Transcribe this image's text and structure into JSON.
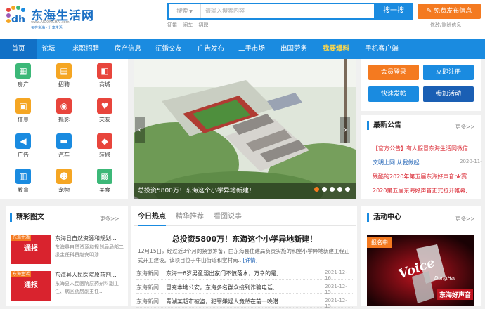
{
  "header": {
    "logo_title": "东海生活网",
    "logo_url": "www.AIDONGHAI.com",
    "logo_slogan": "买在东海 · 分享生活",
    "search_type": "搜索",
    "search_placeholder": "请输入搜索内容",
    "search_button": "搜一搜",
    "quick_links": [
      "征婚",
      "闲车",
      "招聘"
    ],
    "post_button": "免费发布信息",
    "edit_link": "修改/删除信息"
  },
  "nav": {
    "items": [
      {
        "label": "首页"
      },
      {
        "label": "论坛"
      },
      {
        "label": "求职招聘"
      },
      {
        "label": "房产信息"
      },
      {
        "label": "征婚交友"
      },
      {
        "label": "广告发布"
      },
      {
        "label": "二手市场"
      },
      {
        "label": "出国劳务"
      },
      {
        "label": "我要爆料"
      },
      {
        "label": "手机客户端"
      }
    ]
  },
  "categories": [
    {
      "label": "房产",
      "color": "#3cb878",
      "icon": "house-icon",
      "glyph": "▦"
    },
    {
      "label": "招聘",
      "color": "#f5a623",
      "icon": "briefcase-icon",
      "glyph": "▤"
    },
    {
      "label": "商城",
      "color": "#e8453c",
      "icon": "shopping-bag-icon",
      "glyph": "◧"
    },
    {
      "label": "信息",
      "color": "#f5a623",
      "icon": "info-icon",
      "glyph": "▣"
    },
    {
      "label": "摄影",
      "color": "#e8453c",
      "icon": "camera-icon",
      "glyph": "◉"
    },
    {
      "label": "交友",
      "color": "#e8453c",
      "icon": "heart-icon",
      "glyph": "♥"
    },
    {
      "label": "广告",
      "color": "#1a8be0",
      "icon": "megaphone-icon",
      "glyph": "◀"
    },
    {
      "label": "汽车",
      "color": "#1a8be0",
      "icon": "car-icon",
      "glyph": "▬"
    },
    {
      "label": "装修",
      "color": "#e8453c",
      "icon": "location-pin-icon",
      "glyph": "◆"
    },
    {
      "label": "教育",
      "color": "#1a8be0",
      "icon": "book-icon",
      "glyph": "▥"
    },
    {
      "label": "宠物",
      "color": "#f5a623",
      "icon": "cat-icon",
      "glyph": "☻"
    },
    {
      "label": "美食",
      "color": "#3cb878",
      "icon": "food-icon",
      "glyph": "▩"
    }
  ],
  "slider": {
    "caption": "总投资5800万！东海这个小学异地新建！",
    "dots": 5,
    "active_dot": 1
  },
  "side_buttons": {
    "login": "会员登录",
    "register": "立即注册",
    "quick_post": "快速发帖",
    "join": "参加活动"
  },
  "notices": {
    "title": "最新公告",
    "more": "更多>>",
    "items": [
      {
        "text": "【官方公告】有人假冒东海生活网微信...",
        "date": "",
        "style": "red"
      },
      {
        "text": "文明上网 从我做起",
        "date": "2020-11-19",
        "style": "blue"
      },
      {
        "text": "残酷的2020年第五届东海好声音pk赛...",
        "date": "",
        "style": "red"
      },
      {
        "text": "2020第五届东海好声音正式拉开帷幕,...",
        "date": "",
        "style": "red"
      }
    ]
  },
  "featured": {
    "title": "精彩图文",
    "more": "更多>>",
    "items": [
      {
        "tag": "东海生活",
        "thumb": "通报",
        "title": "东海县自然资源和规划...",
        "desc": "东海县自然资源和规划局局部二级主任科员赵安明涉..."
      },
      {
        "tag": "东海生活",
        "thumb": "通报",
        "title": "东海县人民医院原药剂...",
        "desc": "东海县人民医院原药剂科副主任、病区药房副主任..."
      }
    ]
  },
  "center_tabs": [
    "今日热点",
    "精华推荐",
    "看图说事"
  ],
  "hot": {
    "headline": "总投资5800万！东海这个小学异地新建！",
    "summary": "12月15日，经过近3个月的紧张筹备，由东海县住建局负责实施的和堂小学异地新建工程正式开工建设。该项目位于牛山街道和堂村南...",
    "detail_link": "[详情]",
    "items": [
      {
        "src": "东海新闻",
        "title": "东海一6岁男童溺出家门不慎落水，万幸的是,",
        "date": "2021-12-16"
      },
      {
        "src": "东海新闻",
        "title": "冒充本地公安，东海多名群众接到诈骗电话,",
        "date": "2021-12-15"
      },
      {
        "src": "东海新闻",
        "title": "青湖某超市被盗，犯罪嫌疑人竟然在前一晚潜",
        "date": "2021-12-15"
      }
    ]
  },
  "activity": {
    "title": "活动中心",
    "more": "更多>>",
    "badge": "报名中",
    "image_text_main": "Voice",
    "image_text_sub": "东海好声音",
    "image_text_brand": "DongHai"
  }
}
